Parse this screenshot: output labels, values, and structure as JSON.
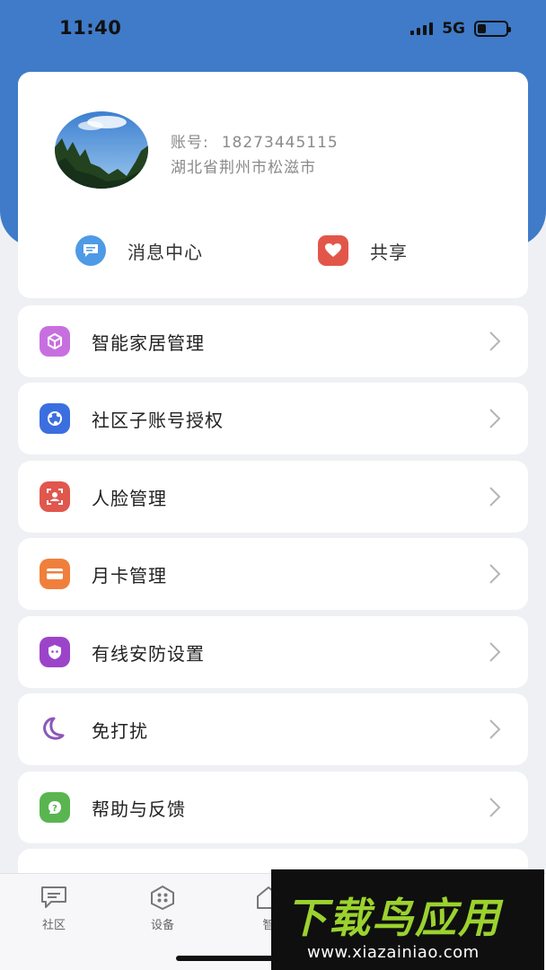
{
  "status": {
    "time": "11:40",
    "network": "5G",
    "battery_level": 0.3
  },
  "profile": {
    "account_label": "账号:",
    "account_number": "18273445115",
    "address": "湖北省荆州市松滋市"
  },
  "quick_actions": [
    {
      "label": "消息中心",
      "icon": "message-icon",
      "color": "#4f9ae6"
    },
    {
      "label": "共享",
      "icon": "heart-icon",
      "color": "#e2564a"
    }
  ],
  "menu": [
    {
      "label": "智能家居管理",
      "icon": "cube-icon",
      "color": "#c86fe0"
    },
    {
      "label": "社区子账号授权",
      "icon": "network-icon",
      "color": "#3b6fe0"
    },
    {
      "label": "人脸管理",
      "icon": "face-icon",
      "color": "#e0574d"
    },
    {
      "label": "月卡管理",
      "icon": "card-icon",
      "color": "#f07f3c"
    },
    {
      "label": "有线安防设置",
      "icon": "shield-icon",
      "color": "#9c44c9"
    },
    {
      "label": "免打扰",
      "icon": "moon-icon",
      "color": "#8d57b8"
    },
    {
      "label": "帮助与反馈",
      "icon": "help-icon",
      "color": "#5ab551"
    }
  ],
  "tabs": [
    {
      "label": "社区",
      "icon": "chat-icon"
    },
    {
      "label": "设备",
      "icon": "devices-icon"
    },
    {
      "label": "智",
      "icon": "home-icon"
    }
  ],
  "watermark": {
    "title": "下载鸟应用",
    "url": "www.xiazainiao.com"
  }
}
